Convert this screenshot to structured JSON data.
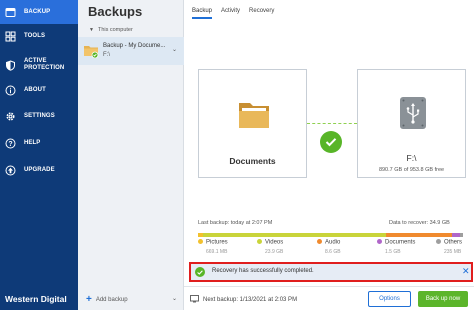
{
  "nav": {
    "items": [
      {
        "label": "BACKUP",
        "icon": "backup-icon",
        "active": true
      },
      {
        "label": "TOOLS",
        "icon": "tools-icon",
        "active": false
      },
      {
        "label": "ACTIVE PROTECTION",
        "icon": "shield-icon",
        "active": false
      },
      {
        "label": "ABOUT",
        "icon": "info-icon",
        "active": false
      },
      {
        "label": "SETTINGS",
        "icon": "gear-icon",
        "active": false
      },
      {
        "label": "HELP",
        "icon": "help-icon",
        "active": false
      },
      {
        "label": "UPGRADE",
        "icon": "upgrade-icon",
        "active": false
      }
    ],
    "footer": "Western Digital"
  },
  "pane": {
    "title": "Backups",
    "section": "This computer",
    "item": {
      "name": "Backup - My Docume...",
      "path": "F:\\"
    },
    "add_label": "Add backup"
  },
  "main": {
    "tabs": [
      {
        "label": "Backup",
        "active": true
      },
      {
        "label": "Activity",
        "active": false
      },
      {
        "label": "Recovery",
        "active": false
      }
    ],
    "source": {
      "label": "Documents"
    },
    "destination": {
      "label": "F:\\",
      "free": "890.7 GB of 953.8 GB free"
    },
    "last_backup": "Last backup: today at 2:07 PM",
    "data_to_recover": "Data to recover: 34.9 GB",
    "legend": [
      {
        "label": "Pictures",
        "size": "669.1 MB",
        "color": "#f2c12e"
      },
      {
        "label": "Videos",
        "size": "23.9 GB",
        "color": "#c9d43a"
      },
      {
        "label": "Audio",
        "size": "8.6 GB",
        "color": "#f08a2e"
      },
      {
        "label": "Documents",
        "size": "1.5 GB",
        "color": "#b066c9"
      },
      {
        "label": "Others",
        "size": "235 MB",
        "color": "#9e9e9e"
      }
    ],
    "usage": [
      {
        "label": "Pictures",
        "fraction": 0.02,
        "color": "#f2c12e"
      },
      {
        "label": "Videos",
        "fraction": 0.69,
        "color": "#c9d43a"
      },
      {
        "label": "Audio",
        "fraction": 0.25,
        "color": "#f08a2e"
      },
      {
        "label": "Documents",
        "fraction": 0.03,
        "color": "#b066c9"
      },
      {
        "label": "Others",
        "fraction": 0.01,
        "color": "#9e9e9e"
      }
    ],
    "notice": "Recovery has successfully completed.",
    "next_backup": "Next backup: 1/13/2021 at 2:03 PM",
    "options_label": "Options",
    "backup_now_label": "Back up now"
  },
  "colors": {
    "nav_bg": "#0e3a78",
    "nav_active": "#2a6fdb",
    "accent": "#1f6fd6",
    "success": "#58b528",
    "alert_border": "#e01e1e"
  }
}
